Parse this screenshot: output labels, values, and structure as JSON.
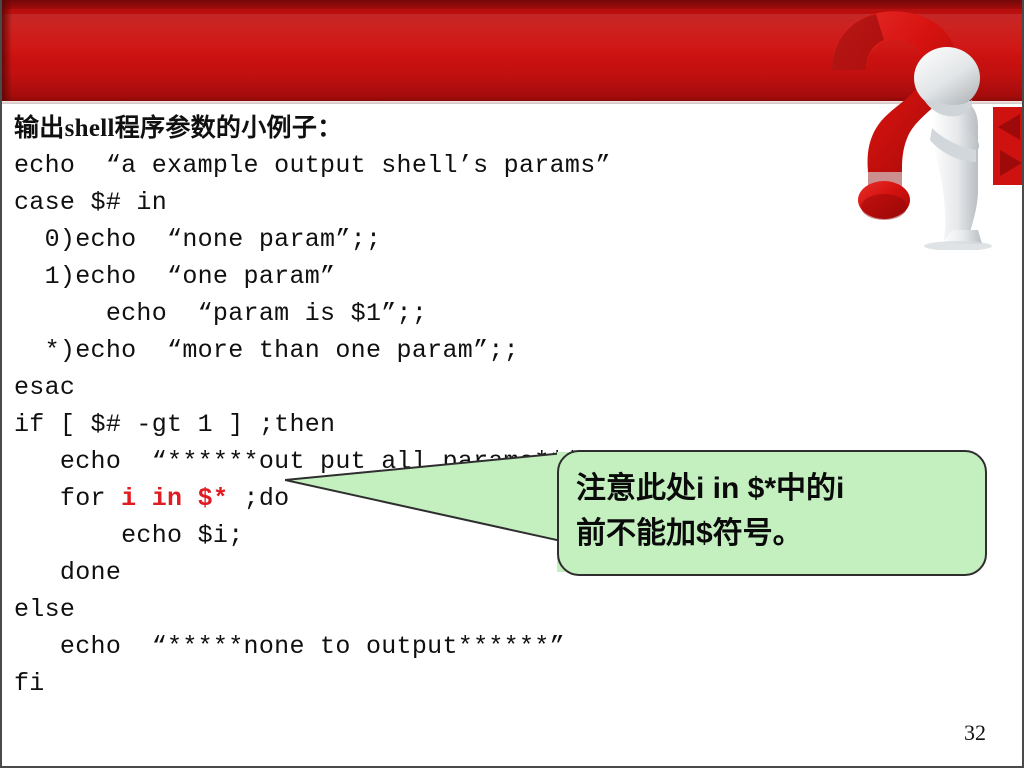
{
  "slide": {
    "page_number": "32",
    "banner_color": "#cf1210",
    "callout_fill": "#c4f0c0",
    "highlight_color": "#e01b22"
  },
  "code": {
    "heading": "输出shell程序参数的小例子：",
    "lines": [
      {
        "text": "echo  “a example output shell’s params”"
      },
      {
        "text": "case $# in"
      },
      {
        "text": "  0)echo  “none param”;;"
      },
      {
        "text": "  1)echo  “one param”"
      },
      {
        "text": "      echo  “param is $1”;;"
      },
      {
        "text": "  *)echo  “more than one param”;;"
      },
      {
        "text": "esac"
      },
      {
        "text": "if [ $# -gt 1 ] ;then"
      },
      {
        "text": "   echo  “******out put all params******”"
      },
      {
        "pre": "   for ",
        "highlight": "i in $*",
        "post": " ;do"
      },
      {
        "text": "       echo $i;"
      },
      {
        "text": "   done"
      },
      {
        "text": "else"
      },
      {
        "text": "   echo  “*****none to output******”"
      },
      {
        "text": "fi"
      }
    ]
  },
  "callout": {
    "note": "注意此处i in $*中的i\n前不能加$符号。"
  },
  "artwork": {
    "question_mark": "question-mark",
    "figure": "thinking-person",
    "arrow_left": "triangle-left-icon",
    "arrow_right": "triangle-right-icon"
  }
}
